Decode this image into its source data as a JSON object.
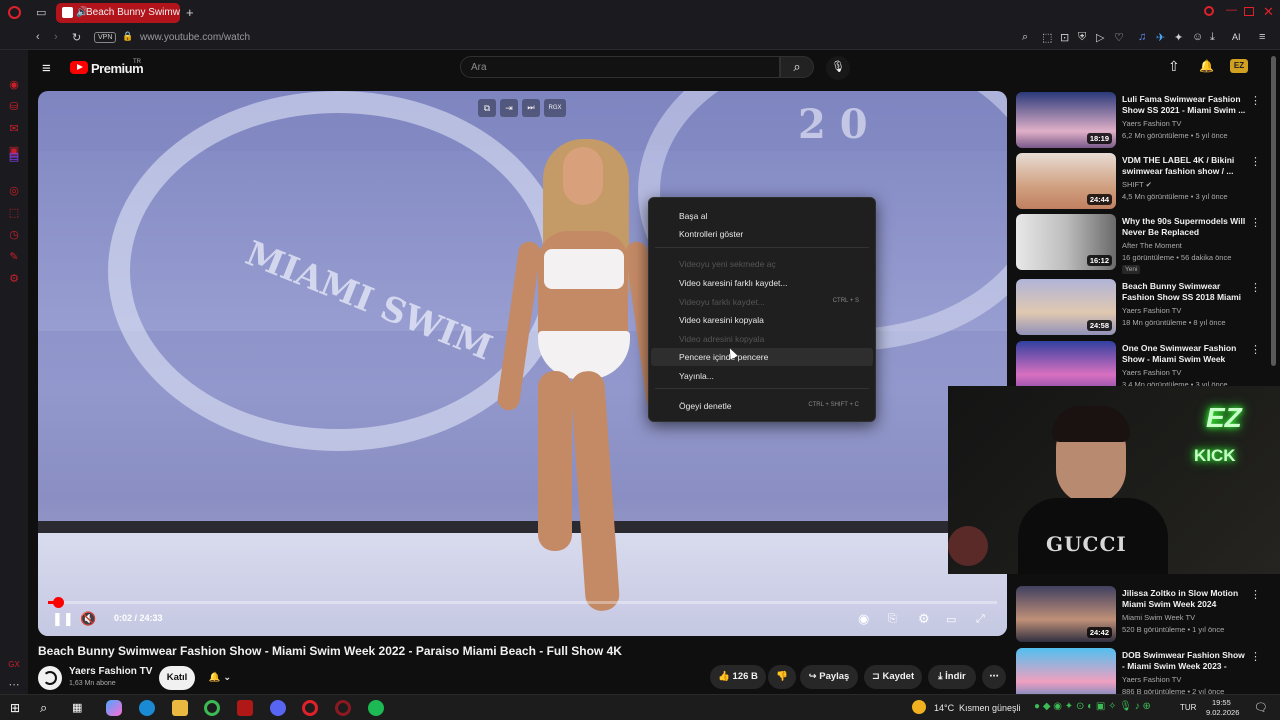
{
  "browser": {
    "tab_title": "Beach Bunny Swimwear",
    "url": "www.youtube.com/watch",
    "vpn_label": "VPN",
    "ai_label": "AI"
  },
  "header": {
    "logo_text": "Premium",
    "logo_sup": "TR",
    "search_placeholder": "Ara"
  },
  "video": {
    "overlay_badge": "RGX",
    "time_text": "0:02 / 24:33",
    "progress_fraction": 0.008
  },
  "context_menu": {
    "items": [
      {
        "label": "Başa al",
        "disabled": false,
        "shortcut": ""
      },
      {
        "label": "Kontrolleri göster",
        "disabled": false,
        "shortcut": ""
      },
      {
        "label": "Videoyu yeni sekmede aç",
        "disabled": true,
        "shortcut": ""
      },
      {
        "label": "Video karesini farklı kaydet...",
        "disabled": false,
        "shortcut": ""
      },
      {
        "label": "Videoyu farklı kaydet...",
        "disabled": true,
        "shortcut": "CTRL + S"
      },
      {
        "label": "Video karesini kopyala",
        "disabled": false,
        "shortcut": ""
      },
      {
        "label": "Video adresini kopyala",
        "disabled": true,
        "shortcut": ""
      },
      {
        "label": "Pencere içinde pencere",
        "disabled": false,
        "shortcut": "",
        "highlighted": true
      },
      {
        "label": "Yayınla...",
        "disabled": false,
        "shortcut": ""
      },
      {
        "label": "Ögeyi denetle",
        "disabled": false,
        "shortcut": "CTRL + SHIFT + C"
      }
    ]
  },
  "watch": {
    "title": "Beach Bunny Swimwear Fashion Show - Miami Swim Week 2022 - Paraiso Miami Beach - Full Show 4K",
    "channel_name": "Yaers Fashion TV",
    "subscribers": "1,63 Mn abone",
    "join_label": "Katıl",
    "likes": "126 B",
    "share_label": "Paylaş",
    "save_label": "Kaydet",
    "download_label": "İndir"
  },
  "recommendations": [
    {
      "title": "Luli Fama Swimwear Fashion Show SS 2021 - Miami Swim ...",
      "channel": "Yaers Fashion TV",
      "meta": "6,2 Mn görüntüleme • 5 yıl önce",
      "duration": "18:19",
      "badge": "",
      "verified": false
    },
    {
      "title": "VDM THE LABEL 4K / Bikini swimwear fashion show / ...",
      "channel": "SHIFT",
      "meta": "4,5 Mn görüntüleme • 3 yıl önce",
      "duration": "24:44",
      "badge": "",
      "verified": true
    },
    {
      "title": "Why the 90s Supermodels Will Never Be Replaced",
      "channel": "After The Moment",
      "meta": "16 görüntüleme • 56 dakika önce",
      "duration": "16:12",
      "badge": "Yeni",
      "verified": false
    },
    {
      "title": "Beach Bunny Swimwear Fashion Show SS 2018 Miami ...",
      "channel": "Yaers Fashion TV",
      "meta": "18 Mn görüntüleme • 8 yıl önce",
      "duration": "24:58",
      "badge": "",
      "verified": false
    },
    {
      "title": "One One Swimwear Fashion Show - Miami Swim Week 202...",
      "channel": "Yaers Fashion TV",
      "meta": "3,4 Mn görüntüleme • 3 yıl önce",
      "duration": "",
      "badge": "",
      "verified": false
    },
    {
      "title": "Jilissa Zoltko in Slow Motion Miami Swim Week 2024",
      "channel": "Miami Swim Week TV",
      "meta": "520 B görüntüleme • 1 yıl önce",
      "duration": "24:42",
      "badge": "",
      "verified": false
    },
    {
      "title": "DOB Swimwear Fashion Show - Miami Swim Week 2023 - DCS...",
      "channel": "Yaers Fashion TV",
      "meta": "886 B görüntüleme • 2 yıl önce",
      "duration": "",
      "badge": "",
      "verified": false
    }
  ],
  "webcam": {
    "sign_line1": "EZ",
    "sign_line2": "KICK",
    "shirt_text": "GUCCI"
  },
  "taskbar": {
    "weather": "14°C",
    "weather_desc": "Kısmen güneşli",
    "lang": "TUR",
    "time": "19:55",
    "date": "9.02.2026"
  },
  "colors": {
    "accent": "#ff0000",
    "tab_active": "#b2141c",
    "opera_red": "#c8202a"
  }
}
